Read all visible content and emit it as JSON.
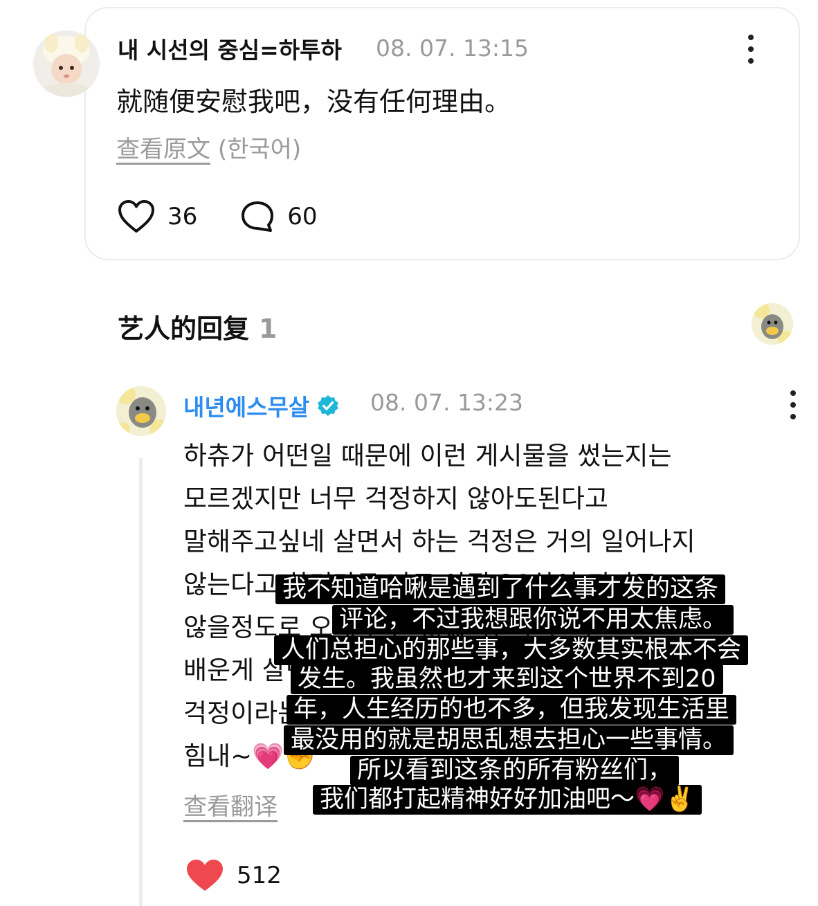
{
  "post": {
    "author": "내 시선의 중심=하투하",
    "time": "08. 07. 13:15",
    "text": "就随便安慰我吧，没有任何理由。",
    "see_original": "查看原文",
    "language": "(한국어)",
    "likes": "36",
    "comments": "60"
  },
  "section": {
    "title": "艺人的回复",
    "count": "1"
  },
  "reply": {
    "author": "내년에스무살",
    "time": "08. 07. 13:23",
    "lines": [
      "하츄가 어떤일 때문에 이런 게시물을 썼는지는",
      "모르겠지만 너무 걱정하지 않아도된다고",
      "말해주고싶네 살면서 하는 걱정은 거의 일어나지",
      "않는다고 하더라구 나도 아직 20살이 되지도",
      "않을정도로 오래 살진 않았지만 살면서",
      "배운게 살면서 제일 쓸모없는게",
      "걱정이라는거야 그러니 이글을 보는 모두",
      "힘내~💗✊"
    ],
    "see_translation": "查看翻译",
    "likes": "512"
  },
  "subtitle_overlay": {
    "lines": [
      "我不知道哈啾是遇到了什么事才发的这条",
      "评论，不过我想跟你说不用太焦虑。",
      "人们总担心的那些事，大多数其实根本不会",
      "发生。我虽然也才来到这个世界不到20",
      "年，人生经历的也不多，但我发现生活里",
      "最没用的就是胡思乱想去担心一些事情。",
      "所以看到这条的所有粉丝们，",
      "我们都打起精神好好加油吧～💗✌️"
    ]
  },
  "colors": {
    "artist_name": "#2d8cf0",
    "verified_badge": "#1fb7d8",
    "liked_heart": "#f0484f",
    "muted_text": "#9a9a9a"
  },
  "icons": {
    "like": "heart-outline-icon",
    "comment": "speech-bubble-icon",
    "more": "more-vertical-icon",
    "verified": "verified-badge-icon",
    "liked": "heart-filled-icon"
  }
}
